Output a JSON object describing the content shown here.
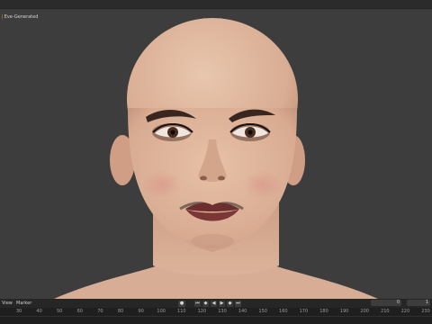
{
  "viewport": {
    "label": "Eve-Generated",
    "background": "#3d3d3d"
  },
  "timeline": {
    "menu": {
      "view": "View",
      "marker": "Marker"
    },
    "playback_icons": [
      "record-icon",
      "jump-start-icon",
      "prev-keyframe-icon",
      "play-reverse-icon",
      "play-icon",
      "next-keyframe-icon",
      "jump-end-icon"
    ],
    "current_frame": "0",
    "start_frame": "1",
    "ruler_ticks": [
      "30",
      "40",
      "50",
      "60",
      "70",
      "80",
      "90",
      "100",
      "110",
      "120",
      "130",
      "140",
      "150",
      "160",
      "170",
      "180",
      "190",
      "200",
      "210",
      "220",
      "230"
    ]
  }
}
